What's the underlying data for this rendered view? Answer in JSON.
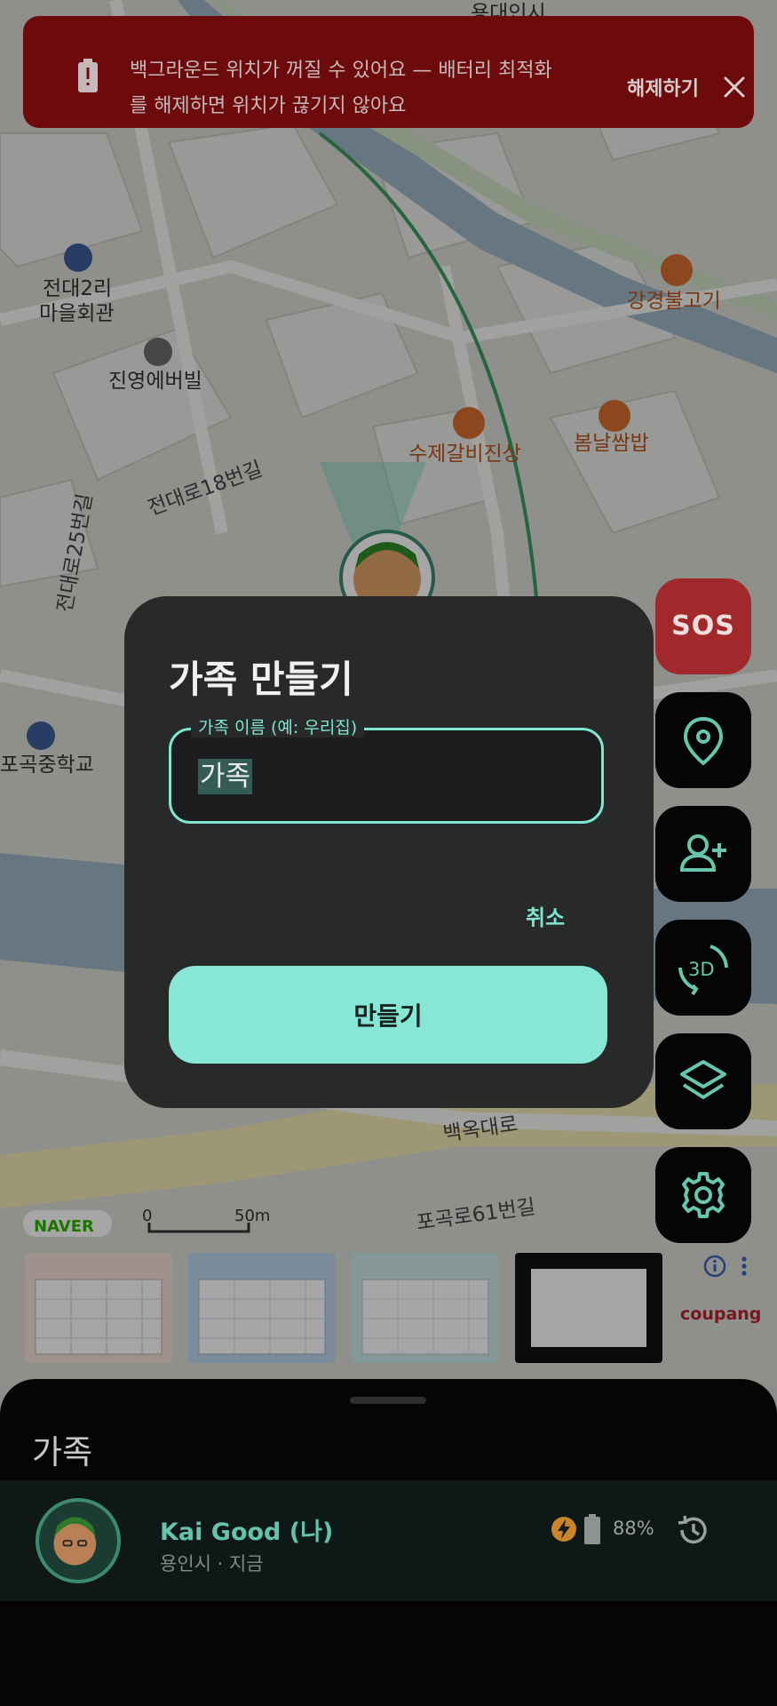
{
  "banner": {
    "message_line1": "백그라운드 위치가 꺼질 수 있어요 — 배터리 최적화",
    "message_line2": "를 해제하면 위치가 끊기지 않아요",
    "action_label": "해제하기",
    "icons": {
      "battery": "battery-alert-icon",
      "close": "close-icon"
    },
    "color": "#6c0a0c"
  },
  "map": {
    "labels": [
      {
        "id": "place-jeondae2ri-1",
        "text": "전대2리"
      },
      {
        "id": "place-jeondae2ri-2",
        "text": "마을회관"
      },
      {
        "id": "place-jinyoung",
        "text": "진영에버빌"
      },
      {
        "id": "road-jeondaero18",
        "text": "전대로18번길"
      },
      {
        "id": "road-jeondaero25",
        "text": "전대로25번길"
      },
      {
        "id": "place-sujegalbi",
        "text": "수제갈비진상"
      },
      {
        "id": "place-bomnal",
        "text": "봄날쌈밥"
      },
      {
        "id": "place-gangkyeong",
        "text": "강경불고기"
      },
      {
        "id": "place-pogok-school",
        "text": "포곡중학교"
      },
      {
        "id": "road-baegokdaero",
        "text": "백옥대로"
      },
      {
        "id": "road-pogokro61",
        "text": "포곡로61번길"
      },
      {
        "id": "place-top-partial",
        "text": "용대인시"
      }
    ],
    "provider": "NAVER",
    "scale_zero": "0",
    "scale_label": "50m"
  },
  "dialog": {
    "title": "가족 만들기",
    "field_label": "가족 이름 (예: 우리집)",
    "field_value": "가족",
    "cancel_label": "취소",
    "create_label": "만들기",
    "accent": "#7fe5d1",
    "button_color": "#88e6d6"
  },
  "fabs": {
    "sos_label": "SOS",
    "three_d_label": "3D",
    "icons": [
      "location-pin-icon",
      "add-person-icon",
      "rotate-3d-icon",
      "layers-icon",
      "gear-icon"
    ]
  },
  "ad": {
    "brand": "coupang",
    "icons": [
      "info-icon",
      "more-vert-icon"
    ]
  },
  "sheet": {
    "title": "가족",
    "member": {
      "name": "Kai Good (나)",
      "subtitle": "용인시 · 지금",
      "battery_percent": "88%",
      "battery_level": 0.88,
      "icons": [
        "charging-icon",
        "battery-icon",
        "history-icon"
      ]
    }
  }
}
